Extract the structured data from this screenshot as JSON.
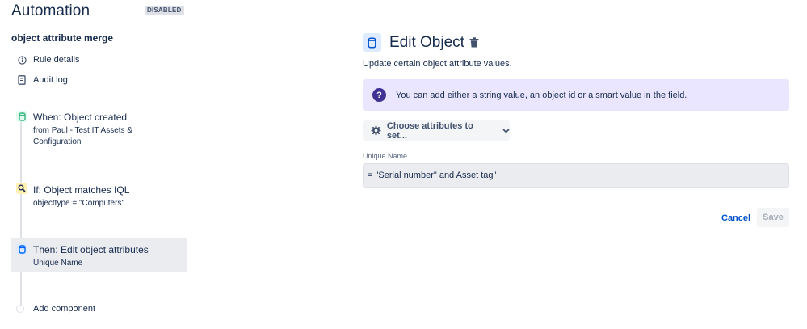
{
  "sidebar": {
    "title": "Automation",
    "status_badge": "DISABLED",
    "rule_name": "object attribute merge",
    "nav": [
      {
        "label": "Rule details",
        "icon": "info-icon"
      },
      {
        "label": "Audit log",
        "icon": "document-icon"
      }
    ],
    "steps": [
      {
        "title": "When: Object created",
        "subtitle": "from Paul - Test IT Assets & Configuration",
        "icon": "object-icon",
        "color": "#36b37e"
      },
      {
        "title": "If: Object matches IQL",
        "subtitle": "objecttype = \"Computers\"",
        "icon": "search-icon",
        "color": "#ffc400"
      },
      {
        "title": "Then: Edit object attributes",
        "subtitle": "Unique Name",
        "icon": "object-icon",
        "color": "#0065ff"
      }
    ],
    "add_component": "Add component"
  },
  "main": {
    "title": "Edit Object",
    "description": "Update certain object attribute values.",
    "info_message": "You can add either a string value, an object id or a smart value in the field.",
    "choose_button": "Choose attributes to set...",
    "field_label": "Unique Name",
    "field_value": "= \"Serial number\" and Asset tag\"",
    "cancel_label": "Cancel",
    "save_label": "Save"
  },
  "colors": {
    "accent": "#0052cc",
    "info_bg": "#eae6ff",
    "info_icon": "#403294"
  }
}
